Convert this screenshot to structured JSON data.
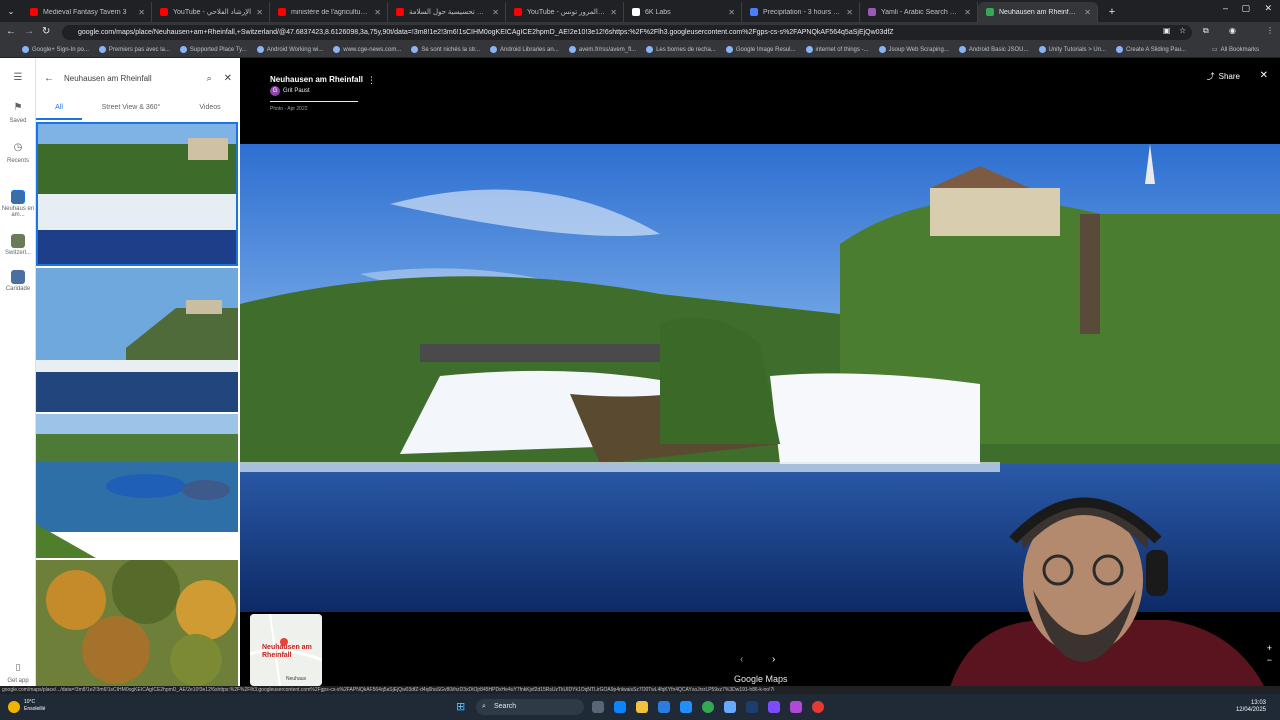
{
  "browser": {
    "tabs": [
      {
        "label": "Medieval Fantasy Tavern 3",
        "color": "#ff0000"
      },
      {
        "label": "YouTube - الإرشاد الفلاحي",
        "color": "#ff0000"
      },
      {
        "label": "ministère de l'agriculture Tunis",
        "color": "#ff0000"
      },
      {
        "label": "ومضة تحسيسية حول السلامة",
        "color": "#ff0000"
      },
      {
        "label": "YouTube - قواعد المرور تونس",
        "color": "#ff0000"
      },
      {
        "label": "6K Labs",
        "color": "#ffffff"
      },
      {
        "label": "Precipitation - 3 hours - Vento",
        "color": "#4a7dff"
      },
      {
        "label": "Yamli - Arabic Search Engine",
        "color": "#9b59b6"
      },
      {
        "label": "Neuhausen am Rheinfall - Goo",
        "color": "#34a853",
        "active": true
      }
    ],
    "url": "google.com/maps/place/Neuhausen+am+Rheinfall,+Switzerland/@47.6837423,8.6126098,3a,75y,90t/data=!3m8!1e2!3m6!1sCIHM0ogKEICAgICE2hpmD_AE!2e10!3e12!6shttps:%2F%2Flh3.googleusercontent.com%2Fgps-cs-s%2FAPNQkAF564q5aSjEjQw03dfZ",
    "bookmarks": [
      "Google+ Sign-In po...",
      "Premiers pas avec la...",
      "Supported Place Ty...",
      "Android Working wi...",
      "www.cge-news.com...",
      "Se sont nichés la str...",
      "Android Libraries an...",
      "avem.fr/rss/avem_fl...",
      "Les bornes de recha...",
      "Google Image Resul...",
      "internet of things -...",
      "Jsoup Web Scraping...",
      "Android Basic JSOU...",
      "Unity Tutorials > Un...",
      "Create A Sliding Pau..."
    ],
    "all_bookmarks": "All Bookmarks"
  },
  "rail": {
    "items": [
      {
        "label": "Saved"
      },
      {
        "label": "Recents"
      },
      {
        "label": "Neuhaus en am..."
      },
      {
        "label": "Switzerl..."
      },
      {
        "label": "Caridade"
      },
      {
        "label": "Get app"
      }
    ]
  },
  "panel": {
    "search_value": "Neuhausen am Rheinfall",
    "tabs": [
      {
        "label": "All",
        "active": true
      },
      {
        "label": "Street View & 360°"
      },
      {
        "label": "Videos"
      }
    ]
  },
  "viewer": {
    "title": "Neuhausen am Rheinfall",
    "author": "Grit Paust",
    "author_initial": "G",
    "meta": "Photo - Apr 2022",
    "share_label": "Share",
    "brand": "Google Maps",
    "minimap_label": "Neuhausen am Rheinfall",
    "minimap_small": "Neuhaus"
  },
  "statusbar": {
    "url": "google.com/maps/place/.../data=!3m8!1e2!3m6!1sCIHM0ogKEICAgICE2hpmD_AE!2e10!3e12!6shttps:%2F%2Flh3.googleusercontent.com%2Fgps-cs-s%2FAPNQkAF564q5aSjEjQw03dfZ-d4q6haSGv80iihzD3xDtOjr845HPDxHe4uY7fnkKjxf2d15RsUzTkUIDYk1OqNTLirGOA9p4nlwaisSz7O0TwL4fqKYfn4QCAYsoJrsrLP59xz7%3Dw191-h86-k-no!7i"
  },
  "taskbar": {
    "weather_temp": "10°C",
    "weather_desc": "Ensoleillé",
    "search_label": "Search",
    "time": "13:03",
    "date": "12/04/2025"
  }
}
